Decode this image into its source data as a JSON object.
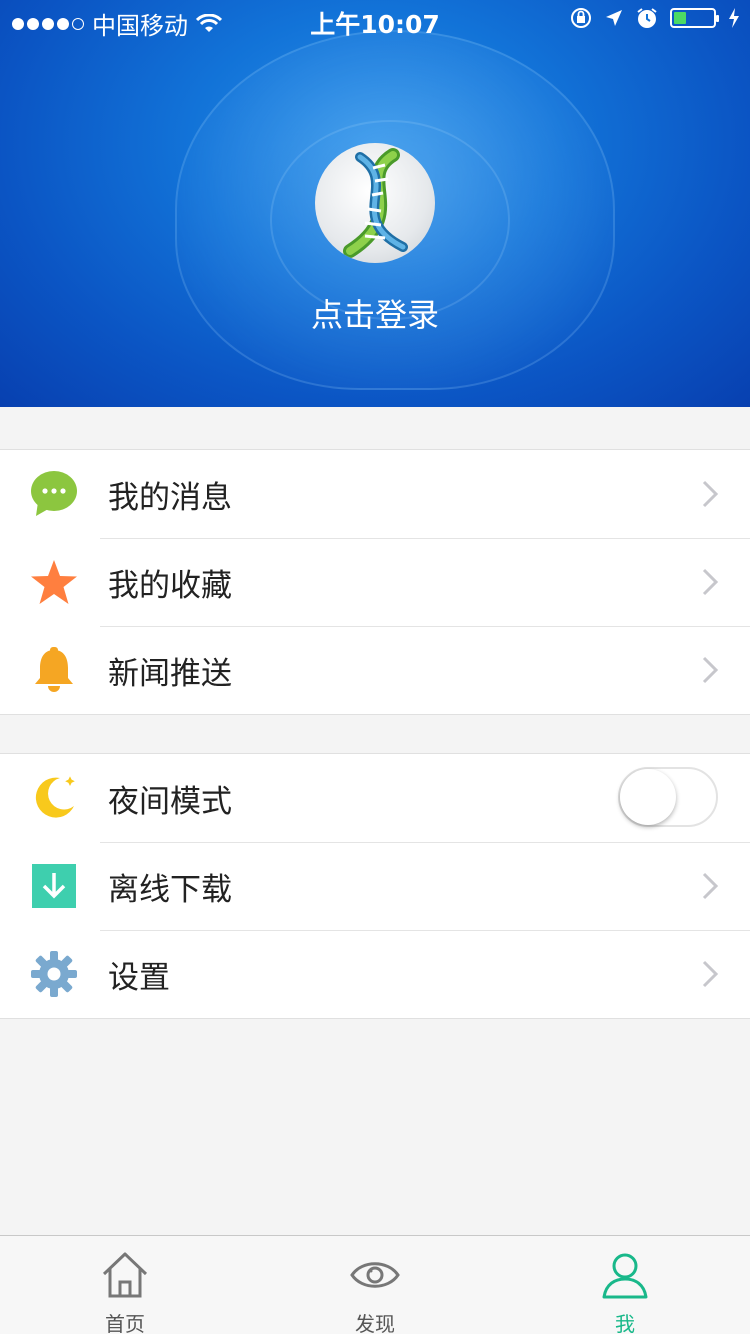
{
  "status_bar": {
    "carrier": "中国移动",
    "time": "上午10:07",
    "battery_color": "#4cd964"
  },
  "profile": {
    "login_label": "点击登录",
    "avatar_icon": "dna-icon"
  },
  "menu_group_1": [
    {
      "label": "我的消息",
      "icon": "message-bubble-icon",
      "icon_color": "#8cc63f"
    },
    {
      "label": "我的收藏",
      "icon": "star-icon",
      "icon_color": "#ff7f3f"
    },
    {
      "label": "新闻推送",
      "icon": "bell-icon",
      "icon_color": "#f5a623"
    }
  ],
  "menu_group_2": [
    {
      "label": "夜间模式",
      "icon": "moon-icon",
      "icon_color": "#f8c91c",
      "toggle_on": false
    },
    {
      "label": "离线下载",
      "icon": "download-icon",
      "icon_color": "#3ecfae"
    },
    {
      "label": "设置",
      "icon": "gear-icon",
      "icon_color": "#7aa9cf"
    }
  ],
  "tabs": [
    {
      "label": "首页",
      "icon": "home-icon",
      "active": false
    },
    {
      "label": "发现",
      "icon": "eye-icon",
      "active": false
    },
    {
      "label": "我",
      "icon": "person-icon",
      "active": true
    }
  ],
  "accent_color": "#19b88a"
}
